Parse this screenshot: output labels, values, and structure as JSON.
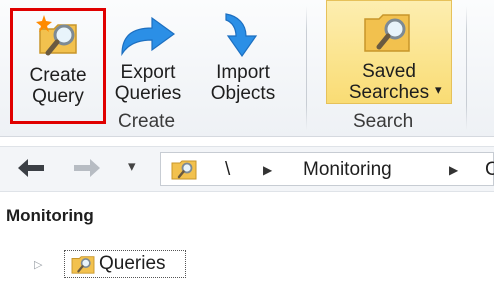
{
  "ribbon": {
    "groups": {
      "create": {
        "label": "Create",
        "buttons": {
          "create_query": {
            "label": "Create\nQuery",
            "icon": "new-query-icon"
          },
          "export_queries": {
            "label": "Export\nQueries",
            "icon": "export-arrow-icon"
          },
          "import_objects": {
            "label": "Import\nObjects",
            "icon": "import-arrow-icon"
          }
        }
      },
      "search": {
        "label": "Search",
        "buttons": {
          "saved_searches": {
            "label": "Saved\nSearches",
            "icon": "saved-search-folder-icon",
            "dropdown": "▾"
          }
        }
      }
    }
  },
  "navigation": {
    "back_icon": "back-arrow-icon",
    "forward_icon": "forward-arrow-icon",
    "history_dropdown": "▾",
    "breadcrumb": [
      "\\",
      "Monitoring",
      "C"
    ]
  },
  "pane": {
    "title": "Monitoring",
    "tree": [
      {
        "label": "Queries",
        "icon": "query-folder-icon",
        "expander": "▷"
      }
    ]
  },
  "colors": {
    "highlight_border": "#e00000",
    "selected_button": "#f9dc74",
    "arrow_blue": "#2b8fe6"
  }
}
